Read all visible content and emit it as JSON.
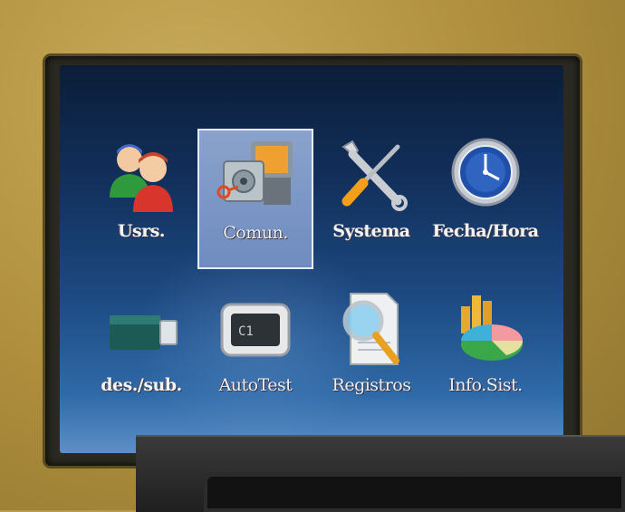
{
  "menu": {
    "items": [
      {
        "label": "Usrs.",
        "icon": "users-icon",
        "selected": false
      },
      {
        "label": "Comun.",
        "icon": "communication-icon",
        "selected": true
      },
      {
        "label": "Systema",
        "icon": "tools-icon",
        "selected": false
      },
      {
        "label": "Fecha/Hora",
        "icon": "clock-icon",
        "selected": false
      },
      {
        "label": "des./sub.",
        "icon": "usb-drive-icon",
        "selected": false
      },
      {
        "label": "AutoTest",
        "icon": "autotest-icon",
        "selected": false
      },
      {
        "label": "Registros",
        "icon": "records-search-icon",
        "selected": false
      },
      {
        "label": "Info.Sist.",
        "icon": "system-info-chart-icon",
        "selected": false
      }
    ]
  },
  "colors": {
    "screen_top": "#0b1d39",
    "screen_bottom": "#5d90c6",
    "selection": "#7f98c6"
  }
}
